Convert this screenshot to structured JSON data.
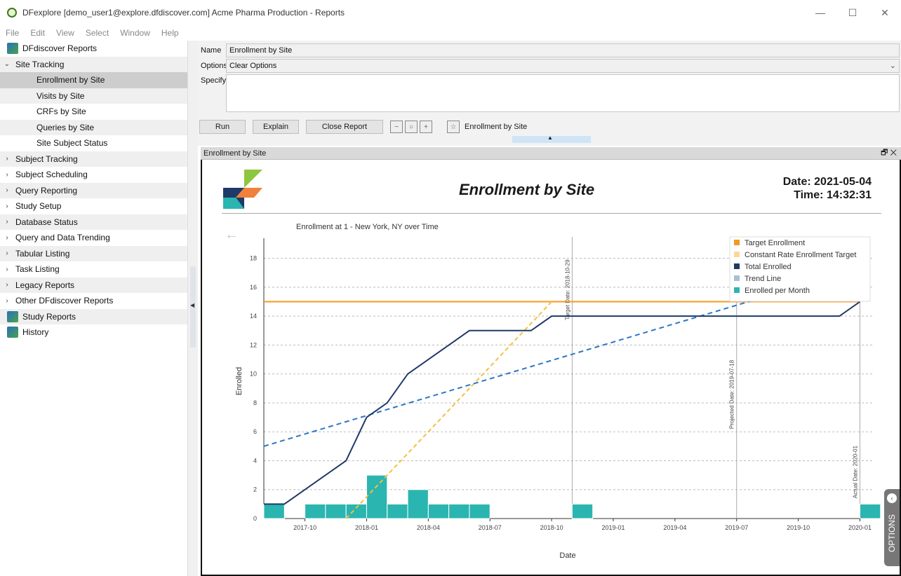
{
  "window": {
    "title": "DFexplore [demo_user1@explore.dfdiscover.com] Acme Pharma Production - Reports",
    "controls": [
      "—",
      "☐",
      "✕"
    ]
  },
  "menu": [
    "File",
    "Edit",
    "View",
    "Select",
    "Window",
    "Help"
  ],
  "sidebar": {
    "root": "DFdiscover Reports",
    "site_tracking": "Site Tracking",
    "site_children": [
      "Enrollment by Site",
      "Visits by Site",
      "CRFs by Site",
      "Queries by Site",
      "Site Subject Status"
    ],
    "groups": [
      "Subject Tracking",
      "Subject Scheduling",
      "Query Reporting",
      "Study Setup",
      "Database Status",
      "Query and Data Trending",
      "Tabular Listing",
      "Task Listing",
      "Legacy Reports",
      "Other DFdiscover Reports"
    ],
    "study_reports": "Study Reports",
    "history": "History"
  },
  "form": {
    "name_label": "Name",
    "name_value": "Enrollment by Site",
    "options_label": "Options",
    "options_value": "Clear Options",
    "specify_label": "Specify",
    "run": "Run",
    "explain": "Explain",
    "close_report": "Close Report",
    "pinned_label": "Enrollment by Site"
  },
  "panel": {
    "title": "Enrollment by Site",
    "controls": "🗗 ✕"
  },
  "report": {
    "title": "Enrollment by Site",
    "date": "Date: 2021-05-04",
    "time": "Time: 14:32:31",
    "subtitle": "Enrollment at 1 - New York, NY over Time",
    "options_tab": "OPTIONS"
  },
  "colors": {
    "target": "#f39a1e",
    "constant_rate": "#fbd89a",
    "total": "#1f3a68",
    "trend": "#2a78c2",
    "bars": "#2ab5b0"
  },
  "chart_data": {
    "type": "bar",
    "title": "",
    "xlabel": "Date",
    "ylabel": "Enrolled",
    "ylim": [
      0,
      19
    ],
    "x_ticks": [
      "2017-10",
      "2018-01",
      "2018-04",
      "2018-07",
      "2018-10",
      "2019-01",
      "2019-04",
      "2019-07",
      "2019-10",
      "2020-01"
    ],
    "y_ticks": [
      0,
      2,
      4,
      6,
      8,
      10,
      12,
      14,
      16,
      18
    ],
    "legend": [
      "Target Enrollment",
      "Constant Rate Enrollment Target",
      "Total Enrolled",
      "Trend Line",
      "Enrolled per Month"
    ],
    "legend_position": "top-right",
    "grid": true,
    "annotations": [
      "Target Date: 2018-10-29",
      "Projected Date: 2019-07-18",
      "Actual Date: 2020-01"
    ],
    "series": [
      {
        "name": "Enrolled per Month",
        "type": "bar",
        "months": [
          "2017-08",
          "2017-09",
          "2017-10",
          "2017-11",
          "2017-12",
          "2018-01",
          "2018-02",
          "2018-03",
          "2018-04",
          "2018-05",
          "2018-06",
          "2018-07",
          "2018-08",
          "2018-09",
          "2018-10",
          "2018-11",
          "2018-12",
          "2019-01",
          "2019-02",
          "2019-03",
          "2019-04",
          "2019-05",
          "2019-06",
          "2019-07",
          "2019-08",
          "2019-09",
          "2019-10",
          "2019-11",
          "2019-12",
          "2020-01"
        ],
        "values": [
          1,
          0,
          1,
          1,
          1,
          3,
          1,
          2,
          1,
          1,
          1,
          0,
          0,
          0,
          0,
          1,
          0,
          0,
          0,
          0,
          0,
          0,
          0,
          0,
          0,
          0,
          0,
          0,
          0,
          1
        ]
      },
      {
        "name": "Total Enrolled",
        "type": "line",
        "points": [
          [
            "2017-08",
            1
          ],
          [
            "2017-09",
            1
          ],
          [
            "2017-10",
            2
          ],
          [
            "2017-11",
            3
          ],
          [
            "2017-12",
            4
          ],
          [
            "2018-01",
            7
          ],
          [
            "2018-02",
            8
          ],
          [
            "2018-03",
            10
          ],
          [
            "2018-04",
            11
          ],
          [
            "2018-05",
            12
          ],
          [
            "2018-06",
            13
          ],
          [
            "2018-07",
            13
          ],
          [
            "2018-08",
            13
          ],
          [
            "2018-09",
            13
          ],
          [
            "2018-10",
            14
          ],
          [
            "2018-11",
            14
          ],
          [
            "2019-12",
            14
          ],
          [
            "2020-01",
            15
          ]
        ]
      },
      {
        "name": "Target Enrollment",
        "type": "line",
        "points": [
          [
            "2017-08",
            15
          ],
          [
            "2020-01",
            15
          ]
        ]
      },
      {
        "name": "Constant Rate Enrollment Target",
        "type": "line-dashed",
        "points": [
          [
            "2017-12",
            0
          ],
          [
            "2018-10",
            15
          ]
        ]
      },
      {
        "name": "Trend Line",
        "type": "line-dashed",
        "points": [
          [
            "2017-08",
            5
          ],
          [
            "2020-01",
            17.3
          ]
        ]
      }
    ]
  }
}
